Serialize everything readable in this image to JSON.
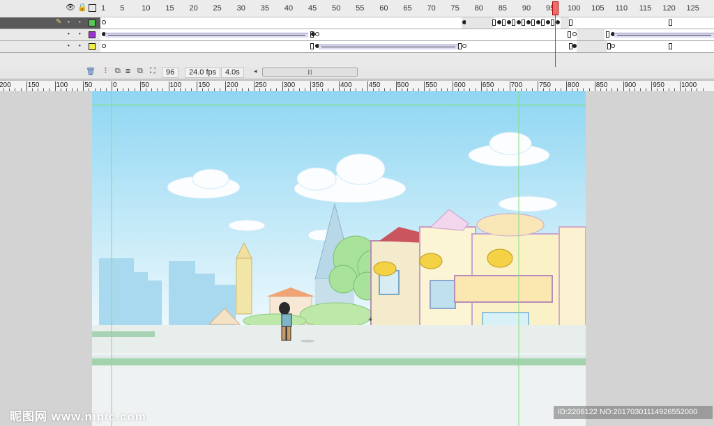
{
  "timeline": {
    "frame_numbers": [
      "1",
      "5",
      "10",
      "15",
      "20",
      "25",
      "30",
      "35",
      "40",
      "45",
      "50",
      "55",
      "60",
      "65",
      "70",
      "75",
      "80",
      "85",
      "90",
      "95",
      "100",
      "105",
      "110",
      "115",
      "120",
      "125"
    ],
    "current_frame_number": "96",
    "header_icons": {
      "eye": "eye-icon",
      "lock": "lock-icon",
      "outline": "outline-square-icon"
    },
    "layers": [
      {
        "swatch_color": "#55cc55",
        "active": true
      },
      {
        "swatch_color": "#9933cc",
        "active": false
      },
      {
        "swatch_color": "#eeee44",
        "active": false
      }
    ]
  },
  "status": {
    "current_frame": "96",
    "frame_rate": "24.0 fps",
    "elapsed_time": "4.0s"
  },
  "ruler": {
    "labels": [
      "200",
      "150",
      "100",
      "50",
      "0",
      "50",
      "100",
      "150",
      "200",
      "250",
      "300",
      "350",
      "400",
      "450",
      "500",
      "550",
      "600",
      "650",
      "700",
      "750",
      "800",
      "850",
      "900",
      "950",
      "1000"
    ]
  },
  "watermarks": {
    "left": "昵图网 www.nipic.com",
    "right": "ID:2206122 NO:20170301114926552000"
  },
  "colors": {
    "sky_top": "#8fd6f2",
    "sky_bottom": "#e9f7fc",
    "guide_green": "#7fdf7f",
    "playhead": "#f26b6b"
  }
}
